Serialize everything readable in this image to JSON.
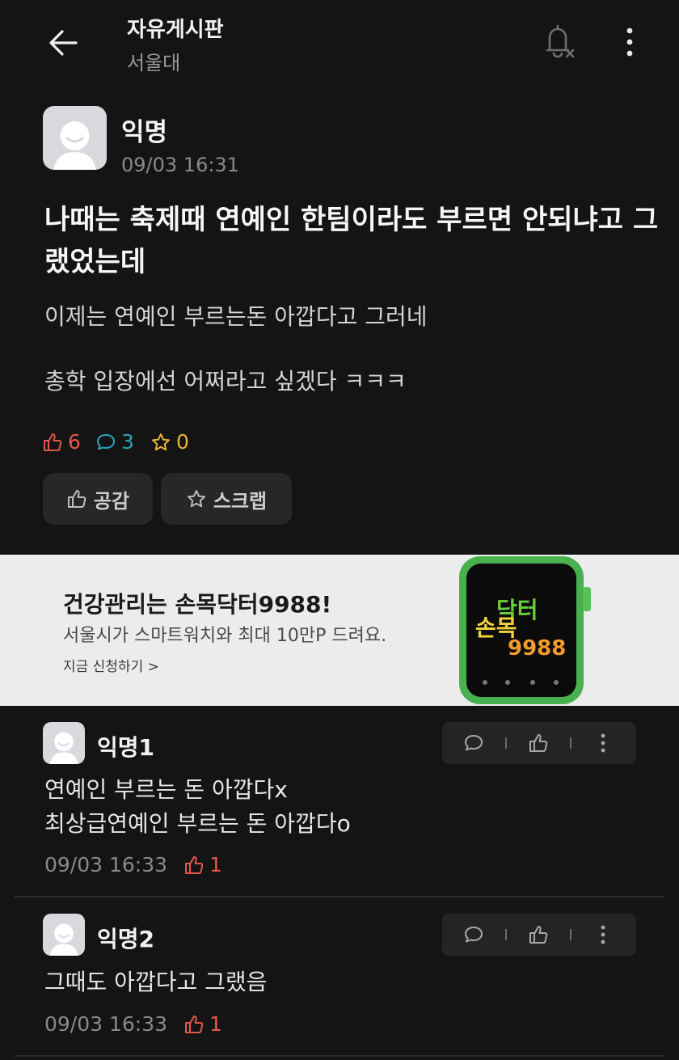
{
  "header": {
    "title": "자유게시판",
    "subtitle": "서울대",
    "back_icon": "arrow-left-icon",
    "notify_icon": "bell-off-icon",
    "more_icon": "more-vertical-icon"
  },
  "post": {
    "author": "익명",
    "time": "09/03 16:31",
    "title": "나때는 축제때 연예인 한팀이라도 부르면 안되냐고 그랬었는데",
    "body": [
      "이제는 연예인 부르는돈 아깝다고 그러네",
      "총학 입장에선 어쩌라고 싶겠다 ㅋㅋㅋ"
    ],
    "stats": {
      "likes": "6",
      "comments": "3",
      "scraps": "0"
    },
    "actions": {
      "like_label": "공감",
      "scrap_label": "스크랩"
    }
  },
  "ad": {
    "title": "건강관리는 손목닥터9988!",
    "subtitle": "서울시가 스마트워치와 최대 10만P 드려요.",
    "cta": "지금 신청하기 >",
    "watch_logo": [
      "손목",
      "닥터",
      "9988"
    ]
  },
  "comments": [
    {
      "author": "익명1",
      "lines": [
        "연예인 부르는 돈 아깝다x",
        "최상급연예인 부르는 돈 아깝다o"
      ],
      "time": "09/03 16:33",
      "likes": "1"
    },
    {
      "author": "익명2",
      "lines": [
        "그때도 아깝다고 그랬음"
      ],
      "time": "09/03 16:33",
      "likes": "1"
    }
  ],
  "colors": {
    "background": "#141414",
    "like": "#e4574b",
    "comment": "#28a6bb",
    "scrap": "#e8b531"
  }
}
